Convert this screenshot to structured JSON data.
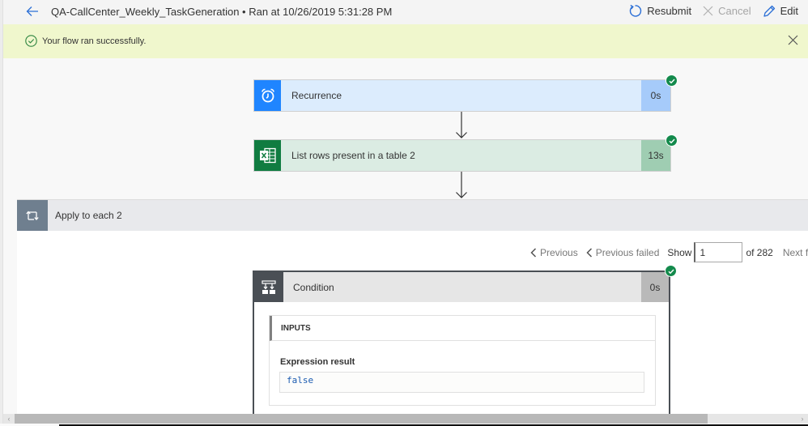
{
  "header": {
    "flow_name": "QA-CallCenter_Weekly_TaskGeneration",
    "separator": "•",
    "run_info": "Ran at 10/26/2019 5:31:28 PM",
    "title_full": "QA-CallCenter_Weekly_TaskGeneration • Ran at 10/26/2019 5:31:28 PM",
    "back_icon": "arrow-left-icon",
    "actions": [
      {
        "label": "Resubmit",
        "icon": "refresh-icon",
        "enabled": true
      },
      {
        "label": "Cancel",
        "icon": "close-icon",
        "enabled": false
      },
      {
        "label": "Edit",
        "icon": "pencil-icon",
        "enabled": true
      }
    ]
  },
  "banner": {
    "message": "Your flow ran successfully.",
    "icon": "check-circle-icon",
    "status_color": "#2e8540",
    "background": "#f0f7cd"
  },
  "steps": [
    {
      "name": "Recurrence",
      "duration": "0s",
      "icon": "alarm-clock-icon",
      "status": "succeeded",
      "accent": "#1f85ff"
    },
    {
      "name": "List rows present in a table 2",
      "duration": "13s",
      "icon": "excel-icon",
      "status": "succeeded",
      "accent": "#107c41"
    }
  ],
  "loop": {
    "name": "Apply to each 2",
    "icon": "loop-icon",
    "pager": {
      "previous": "Previous",
      "previous_failed": "Previous failed",
      "show_label": "Show",
      "current": "1",
      "of_label": "of 282",
      "next": "Next f"
    },
    "condition": {
      "name": "Condition",
      "duration": "0s",
      "icon": "condition-icon",
      "status": "succeeded",
      "inputs_header": "INPUTS",
      "expression_label": "Expression result",
      "expression_value": "false"
    }
  },
  "scrollbar": {
    "left_arrow": "‹",
    "right_arrow": "›"
  }
}
